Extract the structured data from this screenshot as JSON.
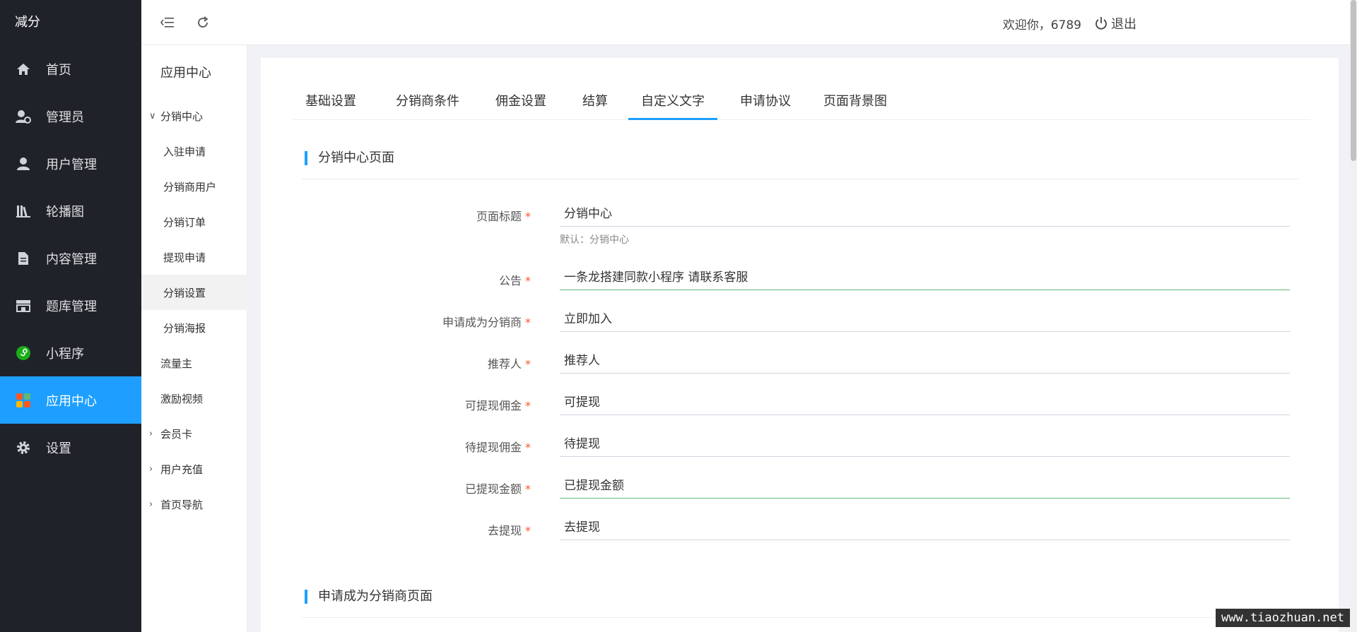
{
  "app": {
    "brand": "减分"
  },
  "sidebar": {
    "items": [
      {
        "label": "首页",
        "icon": "home-icon"
      },
      {
        "label": "管理员",
        "icon": "admin-icon"
      },
      {
        "label": "用户管理",
        "icon": "user-icon"
      },
      {
        "label": "轮播图",
        "icon": "books-icon"
      },
      {
        "label": "内容管理",
        "icon": "document-icon"
      },
      {
        "label": "题库管理",
        "icon": "store-icon"
      },
      {
        "label": "小程序",
        "icon": "miniprogram-icon"
      },
      {
        "label": "应用中心",
        "icon": "apps-icon",
        "active": true
      },
      {
        "label": "设置",
        "icon": "gear-icon"
      }
    ]
  },
  "subnav": {
    "title": "应用中心",
    "items": [
      {
        "label": "分销中心"
      },
      {
        "label": "入驻申请"
      },
      {
        "label": "分销商用户"
      },
      {
        "label": "分销订单"
      },
      {
        "label": "提现申请"
      },
      {
        "label": "分销设置"
      },
      {
        "label": "分销海报"
      },
      {
        "label": "流量主"
      },
      {
        "label": "激励视频"
      },
      {
        "label": "会员卡"
      },
      {
        "label": "用户充值"
      },
      {
        "label": "首页导航"
      }
    ]
  },
  "header": {
    "welcome": "欢迎你，6789",
    "logout": "退出"
  },
  "tabs": [
    "基础设置",
    "分销商条件",
    "佣金设置",
    "结算",
    "自定义文字",
    "申请协议",
    "页面背景图"
  ],
  "sections": {
    "center_page": "分销中心页面",
    "apply_page": "申请成为分销商页面"
  },
  "form": {
    "fields": [
      {
        "label": "页面标题",
        "value": "分销中心",
        "hint": "默认：分销中心"
      },
      {
        "label": "公告",
        "value": "一条龙搭建同款小程序 请联系客服"
      },
      {
        "label": "申请成为分销商",
        "value": "立即加入"
      },
      {
        "label": "推荐人",
        "value": "推荐人"
      },
      {
        "label": "可提现佣金",
        "value": "可提现"
      },
      {
        "label": "待提现佣金",
        "value": "待提现"
      },
      {
        "label": "已提现金额",
        "value": "已提现金额"
      },
      {
        "label": "去提现",
        "value": "去提现"
      }
    ]
  },
  "watermark": "www.tiaozhuan.net",
  "colors": {
    "accent": "#1e9fff",
    "sidebar_bg": "#20222a",
    "required": "#ff5722",
    "focus": "#5fb878"
  }
}
